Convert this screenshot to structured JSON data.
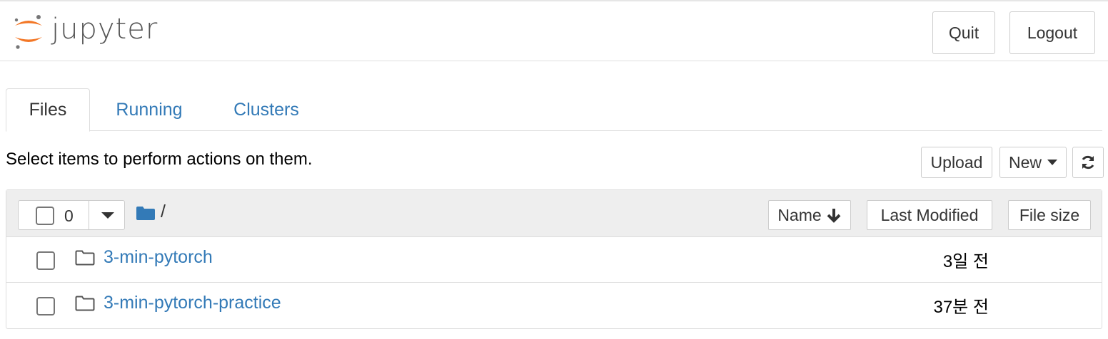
{
  "header": {
    "logo_text": "jupyter",
    "quit_label": "Quit",
    "logout_label": "Logout"
  },
  "tabs": [
    {
      "label": "Files",
      "active": true
    },
    {
      "label": "Running",
      "active": false
    },
    {
      "label": "Clusters",
      "active": false
    }
  ],
  "toolbar": {
    "instructions": "Select items to perform actions on them.",
    "upload_label": "Upload",
    "new_label": "New",
    "refresh_icon": "refresh-icon"
  },
  "list_header": {
    "selected_count": "0",
    "breadcrumb": "/",
    "sort_name_label": "Name",
    "sort_modified_label": "Last Modified",
    "sort_size_label": "File size"
  },
  "items": [
    {
      "name": "3-min-pytorch",
      "modified": "3일 전",
      "icon": "folder-icon"
    },
    {
      "name": "3-min-pytorch-practice",
      "modified": "37분 전",
      "icon": "folder-icon"
    }
  ],
  "colors": {
    "link": "#337ab7",
    "logo_orange": "#f37726",
    "logo_gray": "#767677"
  }
}
